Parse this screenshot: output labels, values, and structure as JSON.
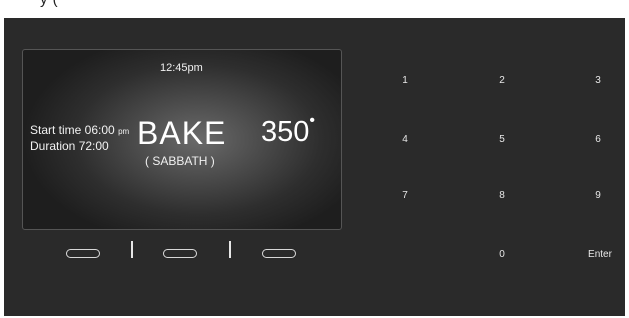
{
  "header": {
    "caption_fragment": "y   ("
  },
  "display": {
    "clock": "12:45pm",
    "start_label": "Start time 06:00",
    "start_ampm": "pm",
    "duration_label": "Duration  72:00",
    "mode": "BAKE",
    "submode": "( SABBATH )",
    "temperature": "350",
    "degree_symbol": "•"
  },
  "softkeys": [
    "oval-button-left",
    "oval-button-center",
    "oval-button-right"
  ],
  "keypad": {
    "k1": "1",
    "k2": "2",
    "k3": "3",
    "k4": "4",
    "k5": "5",
    "k6": "6",
    "k7": "7",
    "k8": "8",
    "k9": "9",
    "k0": "0",
    "enter": "Enter"
  },
  "colors": {
    "panel": "#2a2a2a",
    "text": "#ffffff"
  }
}
